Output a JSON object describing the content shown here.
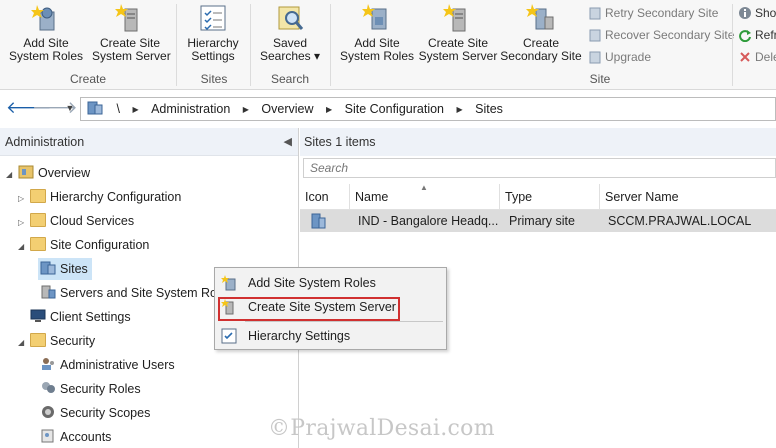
{
  "ribbon": {
    "buttons": {
      "add_site_system_roles": "Add Site\nSystem Roles",
      "create_site_system_server": "Create Site\nSystem Server",
      "hierarchy_settings": "Hierarchy\nSettings",
      "saved_searches": "Saved\nSearches ▾",
      "add_site_system_roles_2": "Add Site\nSystem Roles",
      "create_site_system_server_2": "Create Site\nSystem Server",
      "create_secondary_site": "Create\nSecondary Site"
    },
    "small_buttons": {
      "retry_secondary_site": "Retry Secondary Site",
      "recover_secondary_site": "Recover Secondary Site",
      "upgrade": "Upgrade",
      "show": "Sho",
      "refresh": "Refr",
      "delete": "Dele"
    },
    "groups": {
      "create": "Create",
      "sites": "Sites",
      "search": "Search",
      "site": "Site"
    }
  },
  "address": {
    "root": "\\",
    "crumbs": [
      "Administration",
      "Overview",
      "Site Configuration",
      "Sites"
    ]
  },
  "left_pane": {
    "title": "Administration",
    "tree": {
      "overview": "Overview",
      "hierarchy_configuration": "Hierarchy Configuration",
      "cloud_services": "Cloud Services",
      "site_configuration": "Site Configuration",
      "sites": "Sites",
      "servers_and_site_system_roles": "Servers and Site System Rol",
      "client_settings": "Client Settings",
      "security": "Security",
      "administrative_users": "Administrative Users",
      "security_roles": "Security Roles",
      "security_scopes": "Security Scopes",
      "accounts": "Accounts"
    }
  },
  "right_pane": {
    "title": "Sites 1 items",
    "search_placeholder": "Search",
    "columns": [
      "Icon",
      "Name",
      "Type",
      "Server Name"
    ],
    "rows": [
      {
        "name": "IND - Bangalore Headq...",
        "type": "Primary site",
        "server": "SCCM.PRAJWAL.LOCAL"
      }
    ]
  },
  "context_menu": {
    "items": [
      "Add Site System Roles",
      "Create Site System Server",
      "Hierarchy Settings"
    ]
  },
  "watermark": "©PrajwalDesai.com",
  "colors": {
    "highlight_border": "#d03030",
    "selected_bg": "#cce4f7",
    "row_bg": "#dcdcdc"
  }
}
